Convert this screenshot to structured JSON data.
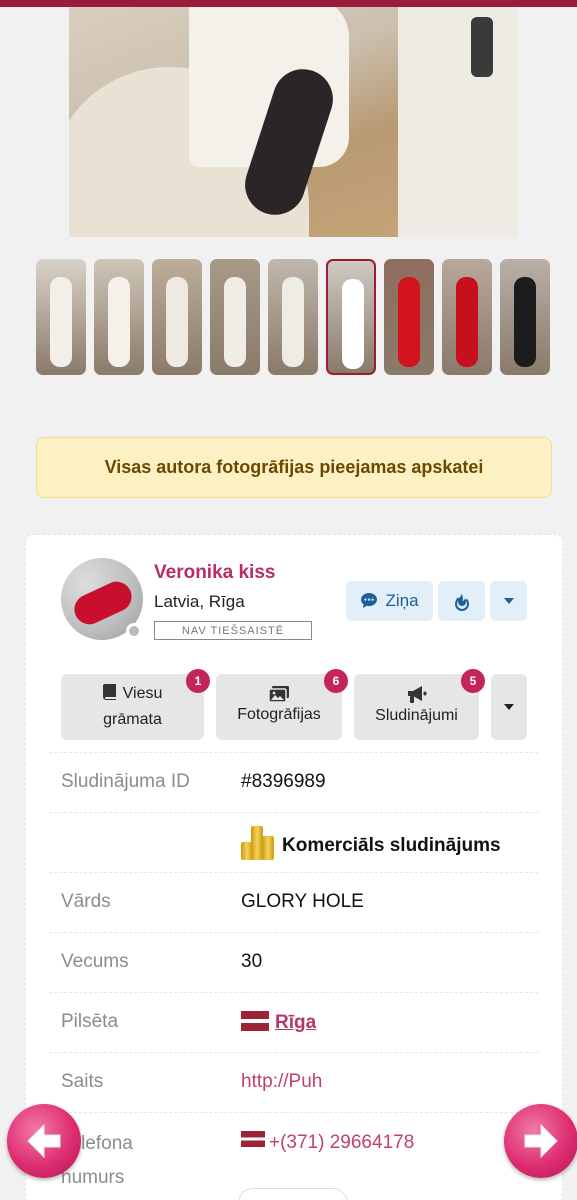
{
  "gallery": {
    "thumbnail_count": 9,
    "active_thumbnail": 6,
    "thumbnails": [
      {
        "tone": "#d9d2c8",
        "figure": "#f2efe9"
      },
      {
        "tone": "#cfc6b8",
        "figure": "#f5f1ea"
      },
      {
        "tone": "#bcae9a",
        "figure": "#efe9df"
      },
      {
        "tone": "#a79a88",
        "figure": "#f0ece6"
      },
      {
        "tone": "#c0b7ad",
        "figure": "#efebe5"
      },
      {
        "tone": "#cfcac3",
        "figure": "#ffffff"
      },
      {
        "tone": "#8f6e5e",
        "figure": "#d3141c"
      },
      {
        "tone": "#b9a79c",
        "figure": "#c8101c"
      },
      {
        "tone": "#b8b0a8",
        "figure": "#1c1c1c"
      }
    ]
  },
  "notice": {
    "text": "Visas autora fotogrāfijas pieejamas apskatei"
  },
  "profile": {
    "name": "Veronika kiss",
    "location": "Latvia, Rīga",
    "status": "Nav tiešsaistē",
    "message_label": "Ziņa"
  },
  "tabs": [
    {
      "label_line1": "Viesu",
      "label_line2": "grāmata",
      "count": "1"
    },
    {
      "label": "Fotogrāfijas",
      "count": "6"
    },
    {
      "label": "Sludinājumi",
      "count": "5"
    }
  ],
  "details": {
    "ad_id_label": "Sludinājuma ID",
    "ad_id_value": "#8396989",
    "commercial_label": "Komerciāls sludinājums",
    "name_label": "Vārds",
    "name_value": "GLORY HOLE",
    "age_label": "Vecums",
    "age_value": "30",
    "city_label": "Pilsēta",
    "city_value": "Rīga",
    "site_label": "Saits",
    "site_value": "http://Puh",
    "phone_label": "Telefona numurs",
    "phone_label_line1": "Telefona",
    "phone_label_line2": "numurs",
    "phone_value": "+(371) 29664178"
  },
  "colors": {
    "accent": "#9b1c3a",
    "name": "#b82d68",
    "badge": "#c3245c",
    "notice_bg": "#fdf1c4",
    "link": "#c0406e"
  },
  "icons": [
    "message-icon",
    "fire-icon",
    "chevron-down-icon",
    "book-icon",
    "images-icon",
    "megaphone-icon",
    "coins-icon",
    "latvia-flag-icon",
    "arrow-left-icon",
    "arrow-right-icon"
  ]
}
